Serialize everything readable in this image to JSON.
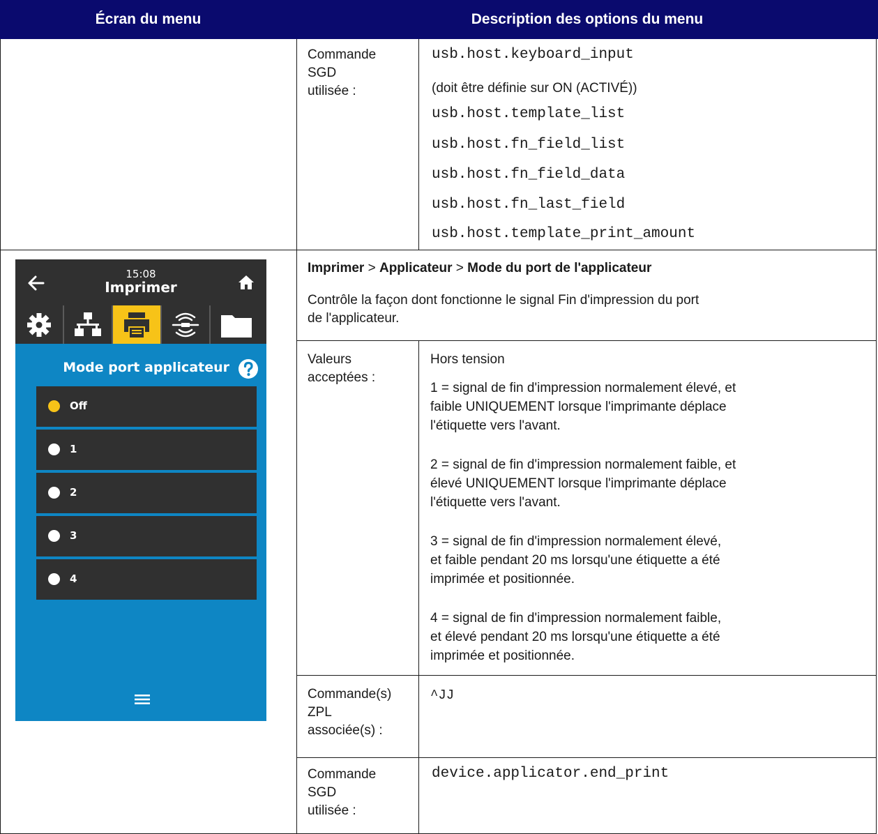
{
  "header": {
    "left": "Écran du menu",
    "right": "Description des options du menu"
  },
  "row1": {
    "label": [
      "Commande",
      "SGD",
      "utilisée :"
    ],
    "items": [
      {
        "text": "usb.host.keyboard_input",
        "mono": true
      },
      {
        "text": "(doit être définie sur ON (ACTIVÉ))",
        "mono": false
      },
      {
        "text": "usb.host.template_list",
        "mono": true
      },
      {
        "text": "usb.host.fn_field_list",
        "mono": true
      },
      {
        "text": "usb.host.fn_field_data",
        "mono": true
      },
      {
        "text": "usb.host.fn_last_field",
        "mono": true
      },
      {
        "text": "usb.host.template_print_amount",
        "mono": true
      }
    ]
  },
  "row2": {
    "breadcrumb": {
      "p1": "Imprimer",
      "sep1": " > ",
      "p2": "Applicateur",
      "sep2": " > ",
      "p3": "Mode du port de l'applicateur"
    },
    "desc_lines": [
      "Contrôle la façon dont fonctionne le signal Fin d'impression du port",
      "de l'applicateur."
    ],
    "values_label": [
      "Valeurs",
      "acceptées :"
    ],
    "values": [
      [
        "Hors tension"
      ],
      [
        "1 = signal de fin d'impression normalement élevé, et",
        "faible UNIQUEMENT lorsque l'imprimante déplace",
        "l'étiquette vers l'avant."
      ],
      [
        "2 = signal de fin d'impression normalement faible, et",
        "élevé UNIQUEMENT lorsque l'imprimante déplace",
        "l'étiquette vers l'avant."
      ],
      [
        "3 = signal de fin d'impression normalement élevé,",
        "et faible pendant 20 ms lorsqu'une étiquette a été",
        "imprimée et positionnée."
      ],
      [
        "4 = signal de fin d'impression normalement faible,",
        "et élevé pendant 20 ms lorsqu'une étiquette a été",
        "imprimée et positionnée."
      ]
    ],
    "zpl_label": [
      "Commande(s)",
      "ZPL",
      "associée(s) :"
    ],
    "zpl_value": "^JJ",
    "sgd_label": [
      "Commande",
      "SGD",
      "utilisée :"
    ],
    "sgd_value": "device.applicator.end_print"
  },
  "device": {
    "time": "15:08",
    "title": "Imprimer",
    "tabs": [
      "gear-icon",
      "network-icon",
      "printer-icon",
      "rfid-icon",
      "folder-icon"
    ],
    "active_tab": 2,
    "panel_title": "Mode port applicateur",
    "options": [
      "Off",
      "1",
      "2",
      "3",
      "4"
    ],
    "selected_option": 0,
    "colors": {
      "accent": "#f7c318",
      "panel_bg": "#0e86c4",
      "dark": "#303030",
      "header_bg": "#0a0a6e"
    }
  }
}
